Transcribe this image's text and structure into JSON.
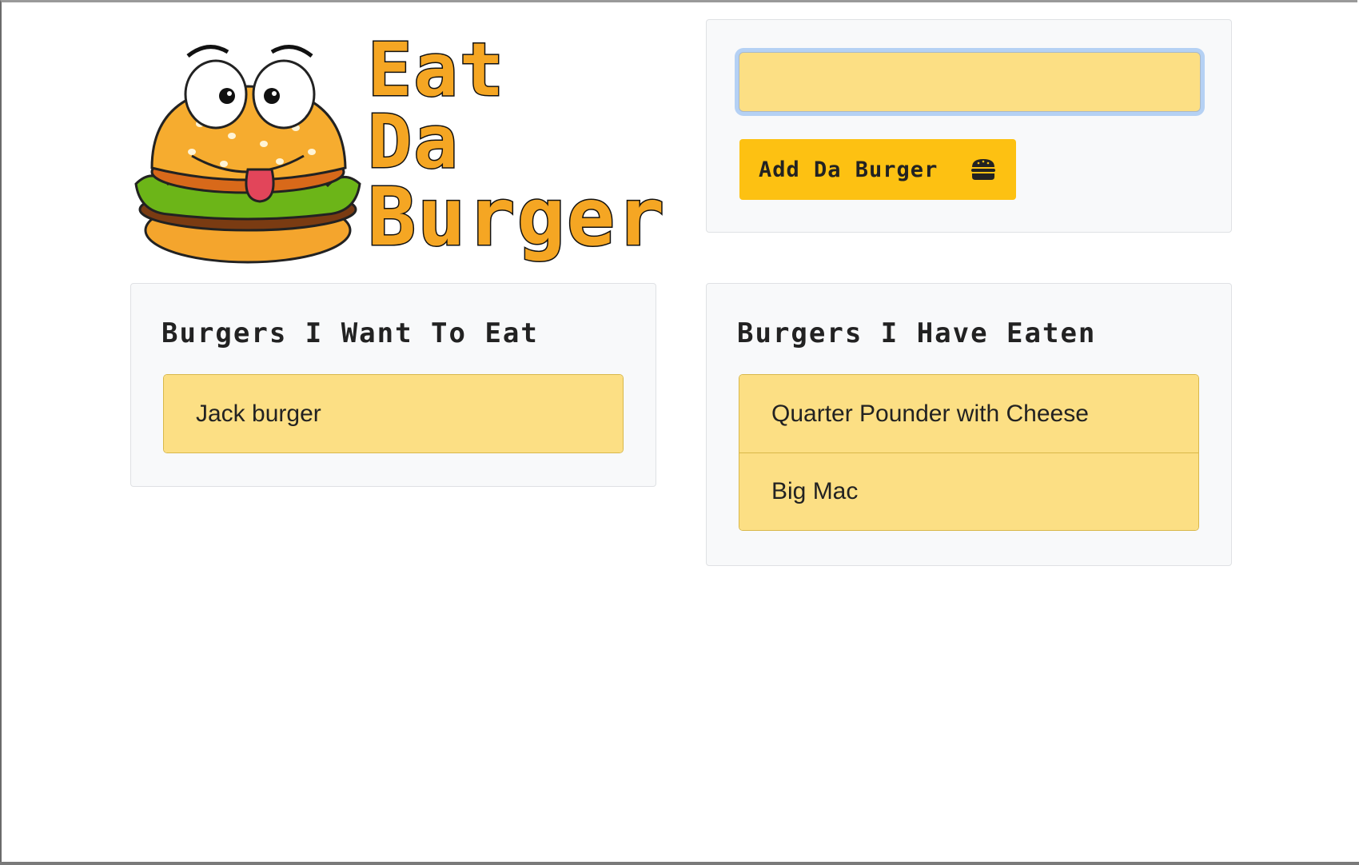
{
  "logo": {
    "line1": "Eat",
    "line2": "Da",
    "line3": "Burger"
  },
  "form": {
    "input_value": "",
    "button_label": "Add Da Burger",
    "button_icon": "hamburger-icon"
  },
  "want": {
    "heading": "Burgers I Want To Eat",
    "items": [
      "Jack burger"
    ]
  },
  "eaten": {
    "heading": "Burgers I Have Eaten",
    "items": [
      "Quarter Pounder with Cheese",
      "Big Mac"
    ]
  },
  "colors": {
    "accent": "#fdc112",
    "list_bg": "#fcdf84",
    "panel_bg": "#f8f9fa",
    "logo_orange": "#f5a623"
  }
}
